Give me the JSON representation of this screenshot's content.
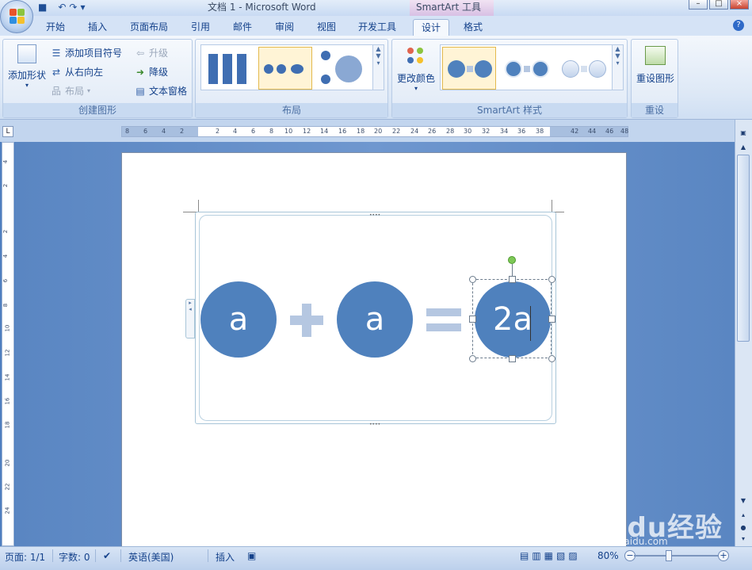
{
  "window": {
    "title": "文档 1 - Microsoft Word",
    "context_title": "SmartArt 工具"
  },
  "tabs": [
    "开始",
    "插入",
    "页面布局",
    "引用",
    "邮件",
    "审阅",
    "视图",
    "开发工具",
    "设计",
    "格式"
  ],
  "ribbon": {
    "create_group": {
      "label": "创建图形",
      "add_shape": "添加形状",
      "add_bullet": "添加项目符号",
      "right_to_left": "从右向左",
      "layout": "布局",
      "promote": "升级",
      "demote": "降级",
      "text_pane": "文本窗格"
    },
    "layout_group": {
      "label": "布局"
    },
    "style_group": {
      "label": "SmartArt 样式",
      "change_colors": "更改颜色"
    },
    "reset_group": {
      "label": "重设",
      "reset_graphic": "重设图形"
    }
  },
  "ruler": {
    "h_ticks": [
      "8",
      "6",
      "4",
      "2",
      "2",
      "4",
      "6",
      "8",
      "10",
      "12",
      "14",
      "16",
      "18",
      "20",
      "22",
      "24",
      "26",
      "28",
      "30",
      "32",
      "34",
      "36",
      "38",
      "42",
      "44",
      "46",
      "48"
    ],
    "v_ticks": [
      "4",
      "2",
      "2",
      "4",
      "6",
      "8",
      "10",
      "12",
      "14",
      "16",
      "18",
      "20",
      "22",
      "24"
    ]
  },
  "smartart": {
    "term1": "a",
    "term2": "a",
    "result": "2a",
    "colors": {
      "circle": "#4f81bd",
      "operator": "#b5c7e1"
    }
  },
  "status": {
    "page": "页面: 1/1",
    "words": "字数: 0",
    "language": "英语(美国)",
    "mode": "插入",
    "zoom": "80%"
  },
  "watermark": {
    "brand": "Baidu经验",
    "url": "jingyan.baidu.com"
  }
}
